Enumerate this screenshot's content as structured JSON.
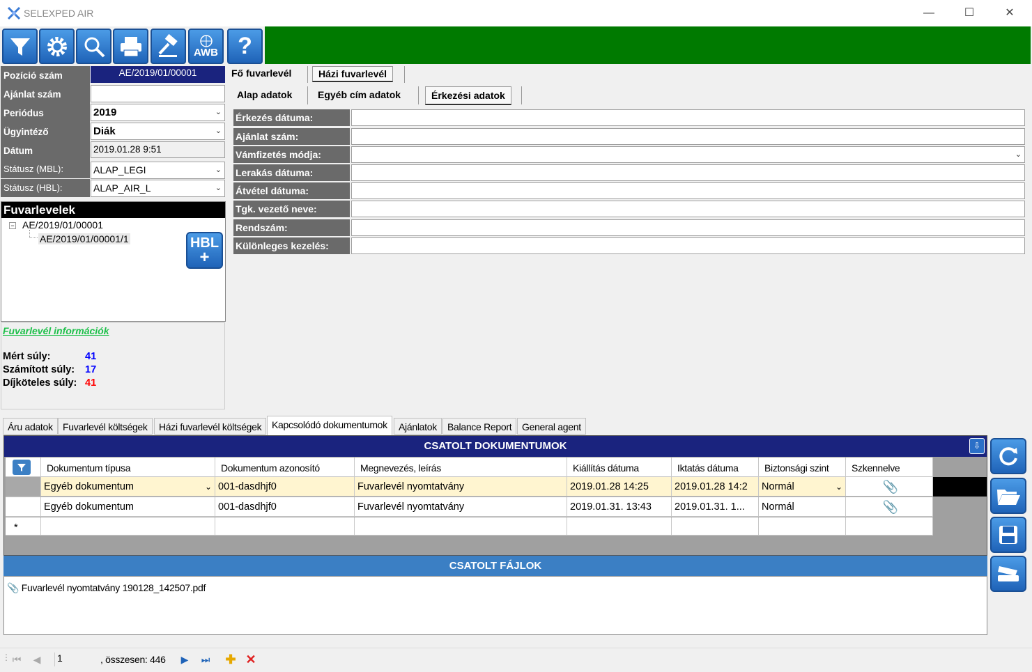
{
  "window": {
    "title": "SELEXPED AIR"
  },
  "toolbar": {
    "buttons": [
      "filter-icon",
      "gear-icon",
      "search-icon",
      "printer-icon",
      "hammer-icon",
      "awb-icon",
      "help-icon"
    ],
    "awb_label": "AWB",
    "help_label": "?"
  },
  "left_form": {
    "pozicio_label": "Pozíció szám",
    "pozicio_value": "AE/2019/01/00001",
    "ajanlat_label": "Ajánlat szám",
    "ajanlat_value": "",
    "periodus_label": "Periódus",
    "periodus_value": "2019",
    "ugyintezo_label": "Ügyintéző",
    "ugyintezo_value": "Diák",
    "datum_label": "Dátum",
    "datum_value": "2019.01.28 9:51",
    "status_mbl_label": "Státusz (MBL):",
    "status_mbl_value": "ALAP_LEGI",
    "status_hbl_label": "Státusz (HBL):",
    "status_hbl_value": "ALAP_AIR_L"
  },
  "fuvarlevelek": {
    "header": "Fuvarlevelek",
    "root": "AE/2019/01/00001",
    "child": "AE/2019/01/00001/1",
    "hbl_label": "HBL",
    "hbl_plus": "+"
  },
  "info": {
    "title": "Fuvarlevél információk",
    "mert_label": "Mért súly:",
    "mert_value": "41",
    "szamitott_label": "Számított súly:",
    "szamitott_value": "17",
    "dijkoteles_label": "Díjköteles súly:",
    "dijkoteles_value": "41",
    "color_blue": "#0000ff",
    "color_red": "#ff0000"
  },
  "top_tabs": {
    "fo": "Fő fuvarlevél",
    "hazi": "Házi fuvarlevél"
  },
  "sub_tabs": {
    "alap": "Alap adatok",
    "egyeb": "Egyéb cím adatok",
    "erkezesi": "Érkezési adatok"
  },
  "arrival_fields": [
    {
      "label": "Érkezés dátuma:",
      "value": ""
    },
    {
      "label": "Ajánlat szám:",
      "value": ""
    },
    {
      "label": "Vámfizetés módja:",
      "value": ""
    },
    {
      "label": "Lerakás dátuma:",
      "value": ""
    },
    {
      "label": "Átvétel dátuma:",
      "value": ""
    },
    {
      "label": "Tgk. vezető neve:",
      "value": ""
    },
    {
      "label": "Rendszám:",
      "value": ""
    },
    {
      "label": "Különleges kezelés:",
      "value": ""
    }
  ],
  "bottom_tabs": [
    "Áru adatok",
    "Fuvarlevél költségek",
    "Házi fuvarlevél költségek",
    "Kapcsolódó dokumentumok",
    "Ajánlatok",
    "Balance Report",
    "General agent"
  ],
  "documents": {
    "header": "CSATOLT DOKUMENTUMOK",
    "columns": [
      "Dokumentum típusa",
      "Dokumentum azonosító",
      "Megnevezés, leírás",
      "Kiállítás dátuma",
      "Iktatás dátuma",
      "Biztonsági szint",
      "Szkennelve"
    ],
    "rows": [
      [
        "Egyéb dokumentum",
        "001-dasdhjf0",
        "Fuvarlevél nyomtatvány",
        "2019.01.28 14:25",
        "2019.01.28 14:2",
        "Normál"
      ],
      [
        "Egyéb dokumentum",
        "001-dasdhjf0",
        "Fuvarlevél nyomtatvány",
        "2019.01.31. 13:43",
        "2019.01.31. 1...",
        "Normál"
      ]
    ],
    "new_row_marker": "*",
    "header_color": "#1a237e"
  },
  "files": {
    "header": "CSATOLT FÁJLOK",
    "items": [
      "Fuvarlevél nyomtatvány 190128_142507.pdf"
    ],
    "header_color": "#3b7fc4"
  },
  "navigator": {
    "position": "1",
    "total_label": ", összesen: 446"
  }
}
